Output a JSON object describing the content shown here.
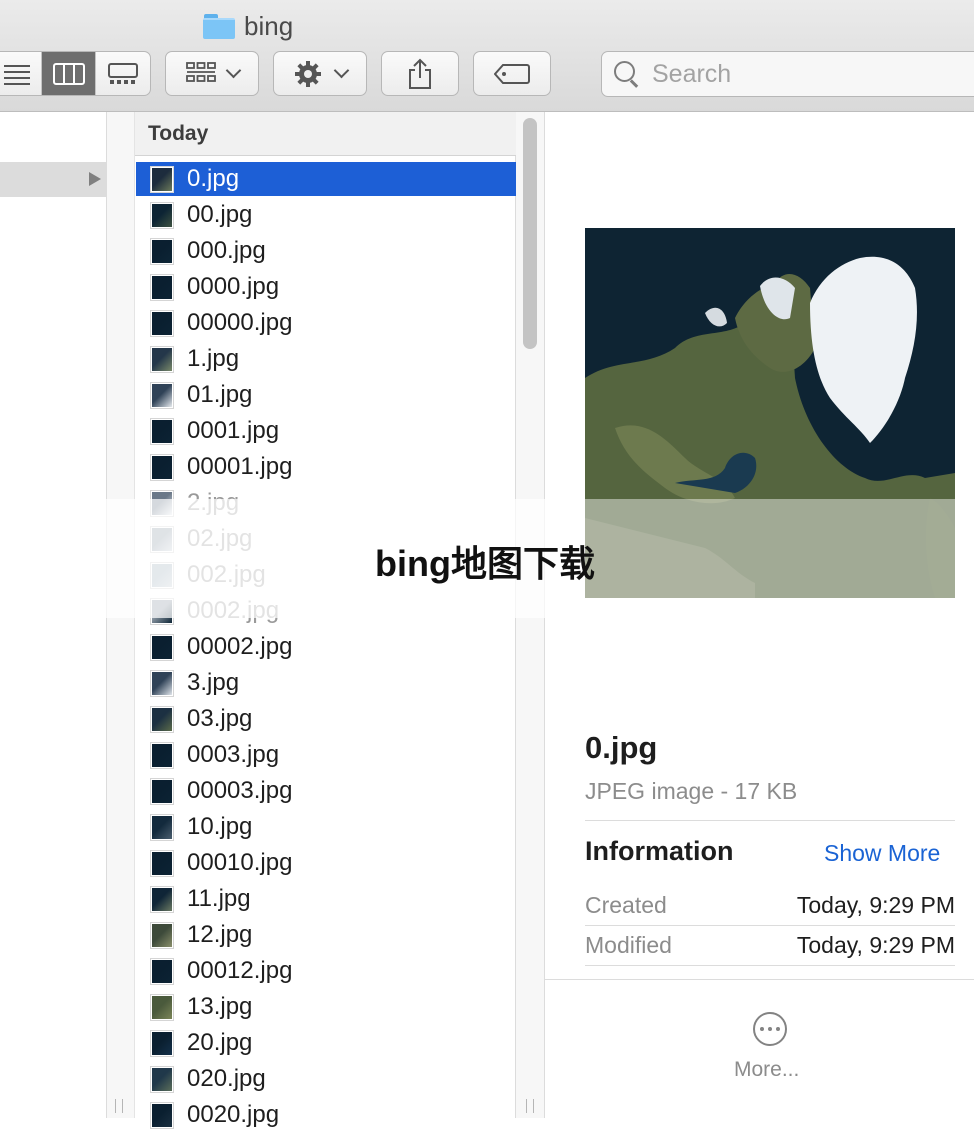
{
  "window": {
    "title": "bing"
  },
  "toolbar": {
    "search_placeholder": "Search",
    "icons": [
      "list-view-icon",
      "column-view-icon",
      "gallery-view-icon",
      "group-icon",
      "gear-icon",
      "share-icon",
      "tag-icon",
      "search-icon"
    ]
  },
  "column2": {
    "header": "Today",
    "files": [
      {
        "name": "0.jpg",
        "thumb": [
          "#1d2c3d",
          "#6c7a5a"
        ]
      },
      {
        "name": "00.jpg",
        "thumb": [
          "#0d2434",
          "#3d5241"
        ]
      },
      {
        "name": "000.jpg",
        "thumb": [
          "#0a1f30",
          "#0d2536"
        ]
      },
      {
        "name": "0000.jpg",
        "thumb": [
          "#0a1f30",
          "#0c2334"
        ]
      },
      {
        "name": "00000.jpg",
        "thumb": [
          "#0a1f30",
          "#0c2334"
        ]
      },
      {
        "name": "1.jpg",
        "thumb": [
          "#24374a",
          "#7a8a6a"
        ]
      },
      {
        "name": "01.jpg",
        "thumb": [
          "#2f4257",
          "#e6eaee"
        ]
      },
      {
        "name": "0001.jpg",
        "thumb": [
          "#0a1f30",
          "#0c2334"
        ]
      },
      {
        "name": "00001.jpg",
        "thumb": [
          "#0a1f30",
          "#0c2334"
        ]
      },
      {
        "name": "2.jpg",
        "thumb": [
          "#6a7888",
          "#e3e7ec"
        ]
      },
      {
        "name": "02.jpg",
        "thumb": [
          "#8c9aa6",
          "#c9d1d8"
        ]
      },
      {
        "name": "002.jpg",
        "thumb": [
          "#9fb0bc",
          "#c3ccd3"
        ]
      },
      {
        "name": "0002.jpg",
        "thumb": [
          "#8894a0",
          "#0d2536"
        ]
      },
      {
        "name": "00002.jpg",
        "thumb": [
          "#0a1f30",
          "#0c2334"
        ]
      },
      {
        "name": "3.jpg",
        "thumb": [
          "#2f4257",
          "#dfe4ea"
        ]
      },
      {
        "name": "03.jpg",
        "thumb": [
          "#1c3042",
          "#5b6b4a"
        ]
      },
      {
        "name": "0003.jpg",
        "thumb": [
          "#0a1f30",
          "#0c2334"
        ]
      },
      {
        "name": "00003.jpg",
        "thumb": [
          "#0a1f30",
          "#0c2334"
        ]
      },
      {
        "name": "10.jpg",
        "thumb": [
          "#132a3d",
          "#4a5e6e"
        ]
      },
      {
        "name": "00010.jpg",
        "thumb": [
          "#0a1f30",
          "#0c2334"
        ]
      },
      {
        "name": "11.jpg",
        "thumb": [
          "#0f2537",
          "#6b7a63"
        ]
      },
      {
        "name": "12.jpg",
        "thumb": [
          "#3d4a3a",
          "#8a8f6b"
        ]
      },
      {
        "name": "00012.jpg",
        "thumb": [
          "#0a1f30",
          "#0c2334"
        ]
      },
      {
        "name": "13.jpg",
        "thumb": [
          "#4a5a3c",
          "#7b8558"
        ]
      },
      {
        "name": "20.jpg",
        "thumb": [
          "#0a1f30",
          "#14304a"
        ]
      },
      {
        "name": "020.jpg",
        "thumb": [
          "#20384a",
          "#5b6e5a"
        ]
      },
      {
        "name": "0020.jpg",
        "thumb": [
          "#0a1f30",
          "#1a2f40"
        ]
      }
    ]
  },
  "preview": {
    "file_name": "0.jpg",
    "kind": "JPEG image - 17 KB",
    "info_title": "Information",
    "show_more": "Show More",
    "rows": [
      {
        "label": "Created",
        "value": "Today, 9:29 PM"
      },
      {
        "label": "Modified",
        "value": "Today, 9:29 PM"
      }
    ],
    "more_label": "More..."
  },
  "banner": {
    "text": "bing地图下载"
  },
  "colors": {
    "selection": "#1d5fd6",
    "link": "#1a63d4",
    "ocean": "#0e2433",
    "ice": "#eef2f5",
    "land": "#5d6b48"
  }
}
